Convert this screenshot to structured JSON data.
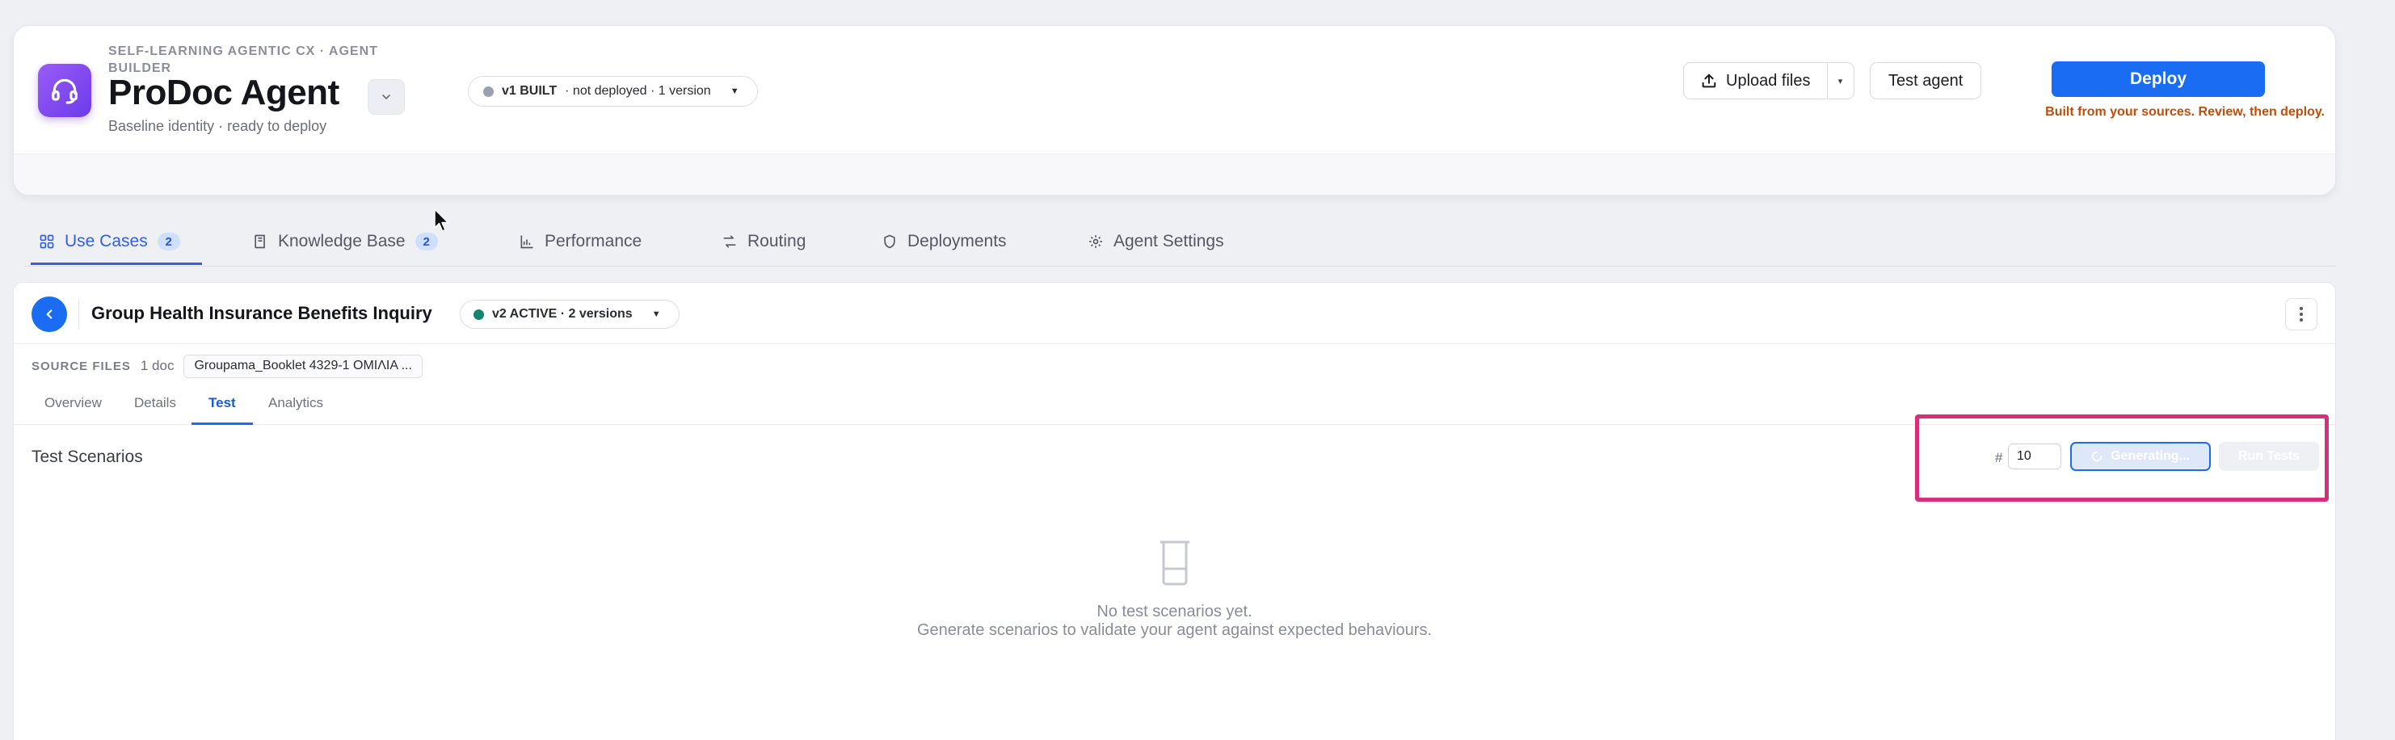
{
  "header": {
    "eyebrow": "SELF-LEARNING AGENTIC CX · AGENT BUILDER",
    "agent_name": "ProDoc Agent",
    "subtitle": "Baseline identity · ready to deploy",
    "version": {
      "label": "v1 BUILT",
      "detail": "· not deployed · 1 version",
      "status_color": "#9aa0ad"
    },
    "upload_label": "Upload files",
    "test_agent_label": "Test agent",
    "deploy_label": "Deploy",
    "deploy_note": "Built from your sources. Review, then deploy."
  },
  "tabs": [
    {
      "label": "Use Cases",
      "badge": "2",
      "icon": "grid-icon"
    },
    {
      "label": "Knowledge Base",
      "badge": "2",
      "icon": "book-icon"
    },
    {
      "label": "Performance",
      "icon": "bar-chart-icon"
    },
    {
      "label": "Routing",
      "icon": "routing-icon"
    },
    {
      "label": "Deployments",
      "icon": "shield-icon"
    },
    {
      "label": "Agent Settings",
      "icon": "gear-icon"
    }
  ],
  "use_case": {
    "title": "Group Health Insurance Benefits Inquiry",
    "version": {
      "label": "v2 ACTIVE · 2 versions",
      "status_color": "#15866b"
    },
    "source_files_label": "SOURCE FILES",
    "source_count": "1 doc",
    "source_file": "Groupama_Booklet 4329-1 ΟΜΙΛΙΑ ..."
  },
  "subtabs": [
    "Overview",
    "Details",
    "Test",
    "Analytics"
  ],
  "test": {
    "section_title": "Test Scenarios",
    "count_label": "#",
    "count_value": "10",
    "generating_label": "Generating...",
    "run_tests_label": "Run Tests",
    "empty_line1": "No test scenarios yet.",
    "empty_line2": "Generate scenarios to validate your agent against expected behaviours."
  },
  "colors": {
    "accent": "#1a6df2",
    "tab_active": "#2f5ee8",
    "warning": "#c14d0a",
    "highlight": "#d6307a"
  }
}
